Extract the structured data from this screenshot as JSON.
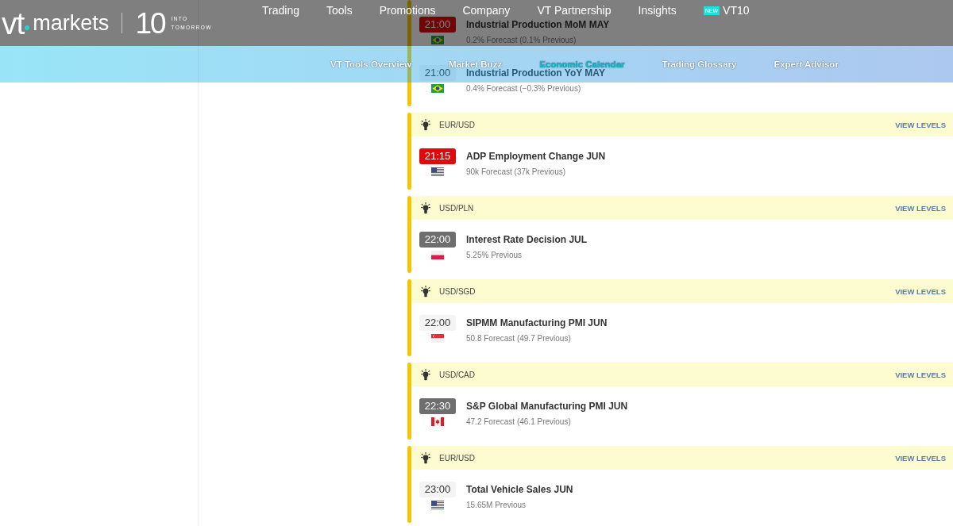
{
  "top_bar": {
    "logo": {
      "mark": "vt",
      "wordmark": "markets"
    },
    "emblem": {
      "number": "10",
      "line_1": "INTO",
      "line_2": "TOMORROW"
    },
    "menu": [
      {
        "label": "Trading"
      },
      {
        "label": "Tools"
      },
      {
        "label": "Promotions"
      },
      {
        "label": "Company"
      },
      {
        "label": "VT Partnership"
      },
      {
        "label": "Insights"
      },
      {
        "label": "VT10",
        "badge": "NEW"
      }
    ]
  },
  "sub_nav": [
    {
      "label": "VT Tools Overview",
      "selected": false
    },
    {
      "label": "Market Buzz",
      "selected": false
    },
    {
      "label": "Economic Calendar",
      "selected": true
    },
    {
      "label": "Trading Glossary",
      "selected": false
    },
    {
      "label": "Expert Advisor",
      "selected": false
    }
  ],
  "calendar": {
    "groups": [
      {
        "events": [
          {
            "time": "21:00",
            "kind": "high",
            "flag": {
              "kind": "brazil"
            },
            "title": "Industrial Production MoM MAY",
            "detail": "0.2% Forecast (0.1% Previous)"
          },
          {
            "time": "21:00",
            "kind": "low",
            "flag": {
              "kind": "brazil"
            },
            "title": "Industrial Production YoY MAY",
            "detail": "0.4% Forecast (−0.3% Previous)"
          }
        ]
      },
      {
        "pair": "EUR/USD",
        "link": "VIEW LEVELS",
        "events": [
          {
            "time": "21:15",
            "kind": "high",
            "flag": {
              "kind": "usa"
            },
            "title": "ADP Employment Change JUN",
            "detail": "90k Forecast (37k Previous)"
          }
        ]
      },
      {
        "pair": "USD/PLN",
        "link": "VIEW LEVELS",
        "events": [
          {
            "time": "22:00",
            "kind": "medium",
            "flag": {
              "kind": "poland"
            },
            "title": "Interest Rate Decision JUL",
            "detail": "5.25% Previous"
          }
        ]
      },
      {
        "pair": "USD/SGD",
        "link": "VIEW LEVELS",
        "events": [
          {
            "time": "22:00",
            "kind": "low",
            "flag": {
              "kind": "singapore"
            },
            "title": "SIPMM Manufacturing PMI JUN",
            "detail": "50.8 Forecast (49.7 Previous)"
          }
        ]
      },
      {
        "pair": "USD/CAD",
        "link": "VIEW LEVELS",
        "events": [
          {
            "time": "22:30",
            "kind": "medium",
            "flag": {
              "kind": "canada"
            },
            "title": "S&P Global Manufacturing PMI JUN",
            "detail": "47.2 Forecast (46.1 Previous)"
          }
        ]
      },
      {
        "pair": "EUR/USD",
        "link": "VIEW LEVELS",
        "events": [
          {
            "time": "23:00",
            "kind": "low",
            "flag": {
              "kind": "usa"
            },
            "title": "Total Vehicle Sales JUN",
            "detail": "15.65M Previous"
          }
        ]
      }
    ]
  }
}
